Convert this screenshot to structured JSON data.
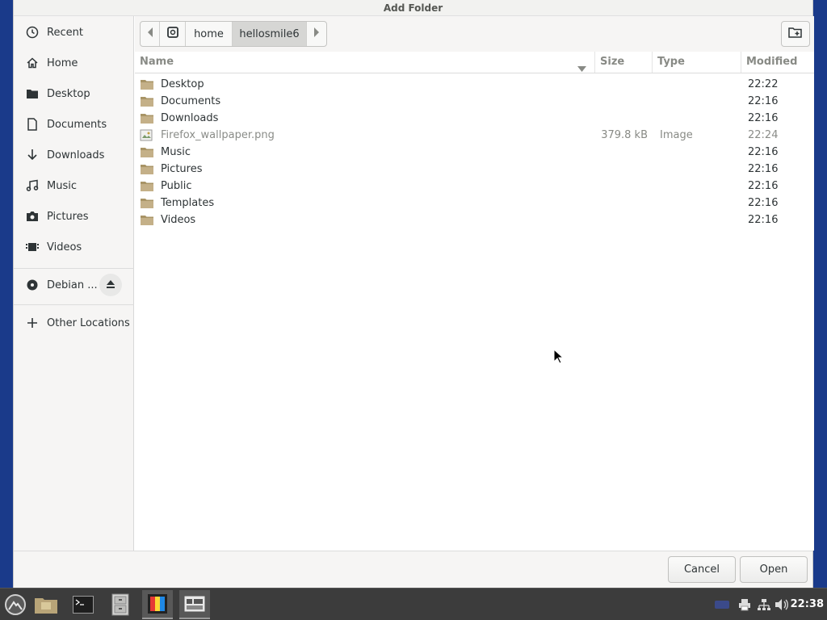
{
  "window": {
    "title": "Add Folder"
  },
  "sidebar": {
    "items": [
      {
        "label": "Recent",
        "icon": "clock-icon"
      },
      {
        "label": "Home",
        "icon": "home-icon"
      },
      {
        "label": "Desktop",
        "icon": "folder-icon"
      },
      {
        "label": "Documents",
        "icon": "document-icon"
      },
      {
        "label": "Downloads",
        "icon": "download-arrow-icon"
      },
      {
        "label": "Music",
        "icon": "music-note-icon"
      },
      {
        "label": "Pictures",
        "icon": "camera-icon"
      },
      {
        "label": "Videos",
        "icon": "video-icon"
      }
    ],
    "devices": [
      {
        "label": "Debian ...",
        "icon": "disc-icon",
        "eject_icon": "eject-icon"
      }
    ],
    "other": {
      "label": "Other Locations",
      "icon": "plus-icon"
    }
  },
  "pathbar": {
    "segments": [
      "home",
      "hellosmile6"
    ],
    "active": "hellosmile6"
  },
  "filelist": {
    "columns": {
      "name": "Name",
      "size": "Size",
      "type": "Type",
      "modified": "Modified"
    },
    "rows": [
      {
        "name": "Desktop",
        "size": "",
        "type": "",
        "modified": "22:22",
        "kind": "folder"
      },
      {
        "name": "Documents",
        "size": "",
        "type": "",
        "modified": "22:16",
        "kind": "folder"
      },
      {
        "name": "Downloads",
        "size": "",
        "type": "",
        "modified": "22:16",
        "kind": "folder"
      },
      {
        "name": "Firefox_wallpaper.png",
        "size": "379.8 kB",
        "type": "Image",
        "modified": "22:24",
        "kind": "image"
      },
      {
        "name": "Music",
        "size": "",
        "type": "",
        "modified": "22:16",
        "kind": "folder"
      },
      {
        "name": "Pictures",
        "size": "",
        "type": "",
        "modified": "22:16",
        "kind": "folder"
      },
      {
        "name": "Public",
        "size": "",
        "type": "",
        "modified": "22:16",
        "kind": "folder"
      },
      {
        "name": "Templates",
        "size": "",
        "type": "",
        "modified": "22:16",
        "kind": "folder"
      },
      {
        "name": "Videos",
        "size": "",
        "type": "",
        "modified": "22:16",
        "kind": "folder"
      }
    ]
  },
  "actions": {
    "cancel": "Cancel",
    "open": "Open"
  },
  "taskbar": {
    "clock": "22:38",
    "apps": [
      "menu-icon",
      "file-manager-icon",
      "terminal-icon",
      "file-cabinet-icon",
      "color-app-icon",
      "window-list-icon"
    ],
    "tray": [
      "keyboard-icon",
      "printer-icon",
      "network-icon",
      "volume-icon"
    ]
  },
  "colors": {
    "folder": "#b09a6c",
    "taskbar": "#3c3c3c",
    "accent": "#4a90d9"
  }
}
